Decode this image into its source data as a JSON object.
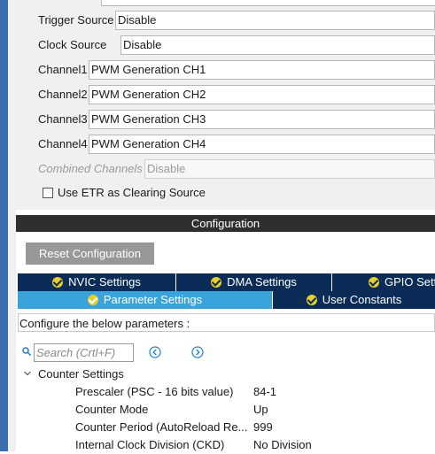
{
  "mode": {
    "trigger_source": {
      "label": "Trigger Source",
      "value": "Disable"
    },
    "clock_source": {
      "label": "Clock Source",
      "value": "Disable"
    },
    "channels": [
      {
        "label": "Channel1",
        "value": "PWM Generation CH1"
      },
      {
        "label": "Channel2",
        "value": "PWM Generation CH2"
      },
      {
        "label": "Channel3",
        "value": "PWM Generation CH3"
      },
      {
        "label": "Channel4",
        "value": "PWM Generation CH4"
      }
    ],
    "combined_channels": {
      "label": "Combined Channels",
      "value": "Disable"
    },
    "etr_checkbox": {
      "label": "Use ETR as Clearing Source",
      "checked": false
    }
  },
  "configuration": {
    "title": "Configuration",
    "reset_label": "Reset Configuration",
    "tabs_row1": [
      "NVIC Settings",
      "DMA Settings",
      "GPIO Settings"
    ],
    "tabs_row2": [
      "Parameter Settings",
      "User Constants"
    ],
    "active_tab": "Parameter Settings",
    "hint": "Configure the below parameters :",
    "search_placeholder": "Search (Crtl+F)"
  },
  "counter_settings": {
    "title": "Counter Settings",
    "params": [
      {
        "name": "Prescaler (PSC - 16 bits value)",
        "value": "84-1"
      },
      {
        "name": "Counter Mode",
        "value": "Up"
      },
      {
        "name": "Counter Period (AutoReload Re...",
        "value": "999"
      },
      {
        "name": "Internal Clock Division (CKD)",
        "value": "No Division"
      }
    ]
  },
  "colors": {
    "header_dark": "#2f2f2f",
    "tab_navy": "#0a2c57",
    "tab_active": "#3aa3db",
    "check_yellow": "#e6cf2c",
    "reset_gray": "#989898",
    "sidebar_blue": "#3b6fb3"
  },
  "icons": [
    "check-icon",
    "search-icon",
    "previous-icon",
    "next-icon",
    "chevron-down-icon"
  ]
}
